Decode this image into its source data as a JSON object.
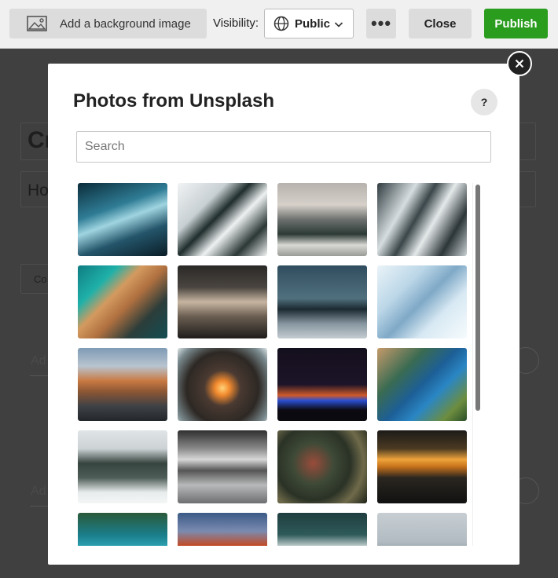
{
  "toolbar": {
    "background_label": "Add a background image",
    "visibility_label": "Visibility:",
    "visibility_value": "Public",
    "more_label": "•••",
    "close_label": "Close",
    "publish_label": "Publish"
  },
  "editor_bg": {
    "title_fragment": "Cr",
    "subtitle_fragment": "Ho",
    "field_fragment": "Co",
    "add_fragment_1": "Ad",
    "add_fragment_2": "Ad"
  },
  "modal": {
    "title": "Photos from Unsplash",
    "help_label": "?",
    "search_placeholder": "Search",
    "search_value": "",
    "photos": [
      {
        "desc": "ice cave",
        "gradient": "linear-gradient(160deg,#0b2c3a 0%,#2f7c95 35%,#9fd4e0 50%,#24556a 70%,#0a1d27 100%)"
      },
      {
        "desc": "snowy mountain ridge",
        "gradient": "linear-gradient(135deg,#f1f3f4 0%,#c8d0d3 30%,#1f2d2c 45%,#eef1f2 60%,#2b3836 80%,#f4f5f5 100%)"
      },
      {
        "desc": "mountain valley mist",
        "gradient": "linear-gradient(180deg,#b8b2ae 0%,#d6d0c9 30%,#6d716f 50%,#2c3a35 70%,#d9d9d5 85%,#9a9c97 100%)"
      },
      {
        "desc": "winding road in snowy forest",
        "gradient": "linear-gradient(120deg,#2f3b3f 0%,#d6dde0 30%,#3a4649 45%,#e4e9ea 60%,#2c3538 80%,#c9d1d3 100%)"
      },
      {
        "desc": "aerial beach",
        "gradient": "linear-gradient(135deg,#0f7d82 0%,#1fb1a9 25%,#d39a5f 40%,#b07040 55%,#2c3d3a 75%,#124e53 100%)"
      },
      {
        "desc": "castle in cliff",
        "gradient": "linear-gradient(180deg,#2a2826 0%,#4a4540 30%,#c7b5a0 50%,#6a5e52 70%,#1e1c1a 100%)"
      },
      {
        "desc": "frozen forest lake",
        "gradient": "linear-gradient(180deg,#2f4d5e 0%,#51707e 45%,#1b2a31 60%,#8796a0 80%,#c4ccd1 100%)"
      },
      {
        "desc": "glacier ice",
        "gradient": "linear-gradient(135deg,#eaf3f8 0%,#bcd7e8 30%,#7fa9c7 50%,#d8e9f3 70%,#f6fbfd 100%)"
      },
      {
        "desc": "half dome sunset",
        "gradient": "linear-gradient(180deg,#7f9bb5 0%,#b8c4cf 25%,#c97a43 45%,#8c5634 60%,#3e4145 80%,#23272b 100%)"
      },
      {
        "desc": "sea arch sunlight",
        "gradient": "radial-gradient(circle at 50% 55%,#ffd27a 0%,#f28a2e 12%,#4a3a32 30%,#2d2824 60%,#7a8a8e 85%,#dfe6e8 100%)"
      },
      {
        "desc": "night lights on water",
        "gradient": "linear-gradient(180deg,#140f1d 0%,#1c1428 50%,#d05a2a 65%,#2a4fd1 72%,#0d0a12 85%,#0a0a0f 100%)"
      },
      {
        "desc": "blue lake cliffs",
        "gradient": "linear-gradient(135deg,#c69a6a 0%,#3a6b52 30%,#1d5f96 50%,#2a86c4 65%,#6d8d3e 85%,#2a4f2a 100%)"
      },
      {
        "desc": "snowy pine trees",
        "gradient": "linear-gradient(180deg,#dfe4e6 0%,#cdd3d5 25%,#36443f 45%,#4f5d58 65%,#e8ecec 85%,#f4f6f6 100%)"
      },
      {
        "desc": "cloud over mountains",
        "gradient": "linear-gradient(180deg,#2f2f2f 0%,#8a8a8a 25%,#d7d7d7 40%,#555 55%,#b7b9ba 75%,#6c6e70 100%)"
      },
      {
        "desc": "autumn forest aerial",
        "gradient": "radial-gradient(circle at 40% 45%,#9a4b3b 0%,#3f4a37 30%,#2a3226 55%,#6f6a4a 75%,#1f2419 100%)"
      },
      {
        "desc": "sunbeams over ocean",
        "gradient": "linear-gradient(180deg,#1c1a18 0%,#4b3a22 25%,#f0a43a 40%,#c4701a 50%,#2a2620 65%,#111 100%)"
      },
      {
        "desc": "tropical shore aerial",
        "gradient": "linear-gradient(180deg,#2b5a3a 0%,#1a7d8a 30%,#36b4c7 55%,#e6dfcf 80%,#f4efe4 100%)"
      },
      {
        "desc": "red rock canyon",
        "gradient": "linear-gradient(180deg,#3b5a86 0%,#7b8bb0 25%,#c24a25 45%,#8e2f1a 65%,#4a1d12 100%)"
      },
      {
        "desc": "ocean waves aerial",
        "gradient": "linear-gradient(180deg,#1f3d3e 0%,#2f5a5a 30%,#e8ecec 50%,#bfcfcf 60%,#2a5052 80%,#163233 100%)"
      },
      {
        "desc": "misty lake",
        "gradient": "linear-gradient(180deg,#c7ced3 0%,#b1bbc1 40%,#8e9aa1 55%,#d4dadd 75%,#e9eced 100%)"
      }
    ]
  },
  "icons": {
    "background": "image-icon",
    "visibility": "globe-icon",
    "dropdown": "chevron-down-icon",
    "close_modal": "close-icon"
  },
  "colors": {
    "publish": "#2a9d1f",
    "overlay": "#404040"
  }
}
